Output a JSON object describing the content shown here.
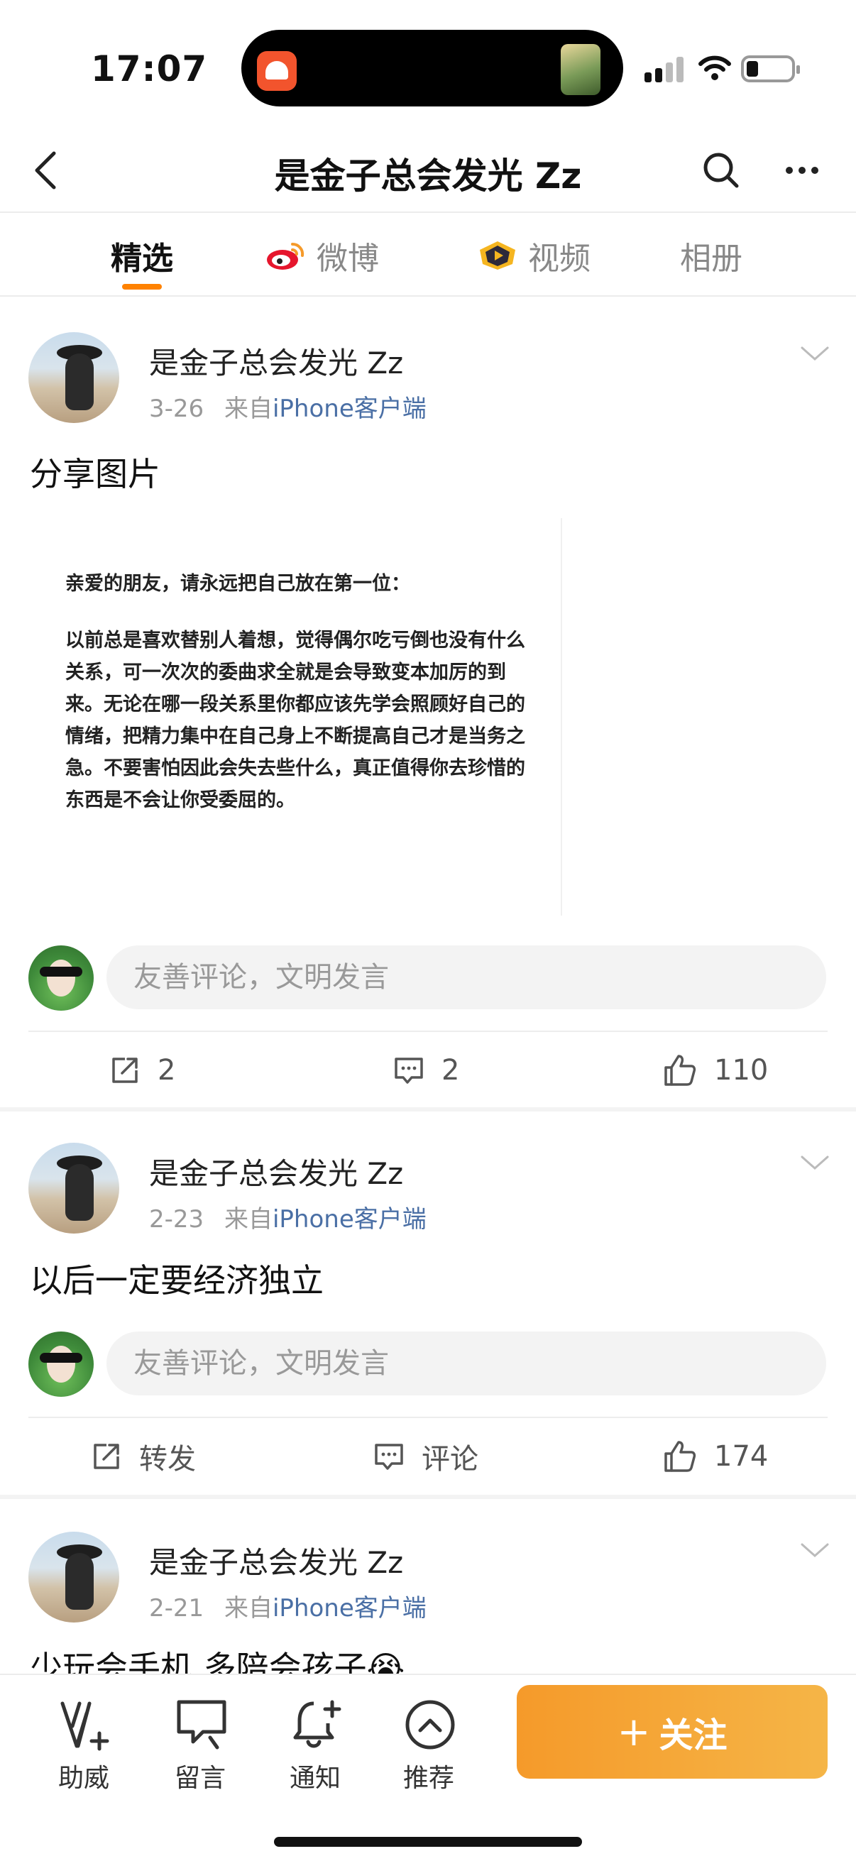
{
  "status_bar": {
    "time": "17:07"
  },
  "header": {
    "title": "是金子总会发光 Zz"
  },
  "tabs": [
    {
      "label": "精选",
      "active": true
    },
    {
      "label": "微博",
      "icon": "weibo-logo-icon"
    },
    {
      "label": "视频",
      "icon": "video-badge-icon"
    },
    {
      "label": "相册"
    }
  ],
  "comment_placeholder": "友善评论，文明发言",
  "posts": [
    {
      "author": "是金子总会发光 Zz",
      "date": "3-26",
      "source_prefix": "来自",
      "source": "iPhone客户端",
      "text": "分享图片",
      "image": {
        "heading": "亲爱的朋友，请永远把自己放在第一位：",
        "body": "以前总是喜欢替别人着想，觉得偶尔吃亏倒也没有什么关系，可一次次的委曲求全就是会导致变本加厉的到来。无论在哪一段关系里你都应该先学会照顾好自己的情绪，把精力集中在自己身上不断提高自己才是当务之急。不要害怕因此会失去些什么，真正值得你去珍惜的东西是不会让你受委屈的。"
      },
      "actions": {
        "repost": "2",
        "comment": "2",
        "like": "110"
      }
    },
    {
      "author": "是金子总会发光 Zz",
      "date": "2-23",
      "source_prefix": "来自",
      "source": "iPhone客户端",
      "text": "以后一定要经济独立",
      "actions": {
        "repost": "转发",
        "comment": "评论",
        "like": "174"
      }
    },
    {
      "author": "是金子总会发光 Zz",
      "date": "2-21",
      "source_prefix": "来自",
      "source": "iPhone客户端",
      "text": "少玩会手机 多陪会孩子😭"
    }
  ],
  "bottom_bar": {
    "items": [
      {
        "label": "助威",
        "icon": "cheer-v-icon"
      },
      {
        "label": "留言",
        "icon": "message-icon"
      },
      {
        "label": "通知",
        "icon": "bell-plus-icon"
      },
      {
        "label": "推荐",
        "icon": "chevron-up-circle-icon"
      }
    ],
    "follow_plus": "+",
    "follow_label": "关注"
  }
}
